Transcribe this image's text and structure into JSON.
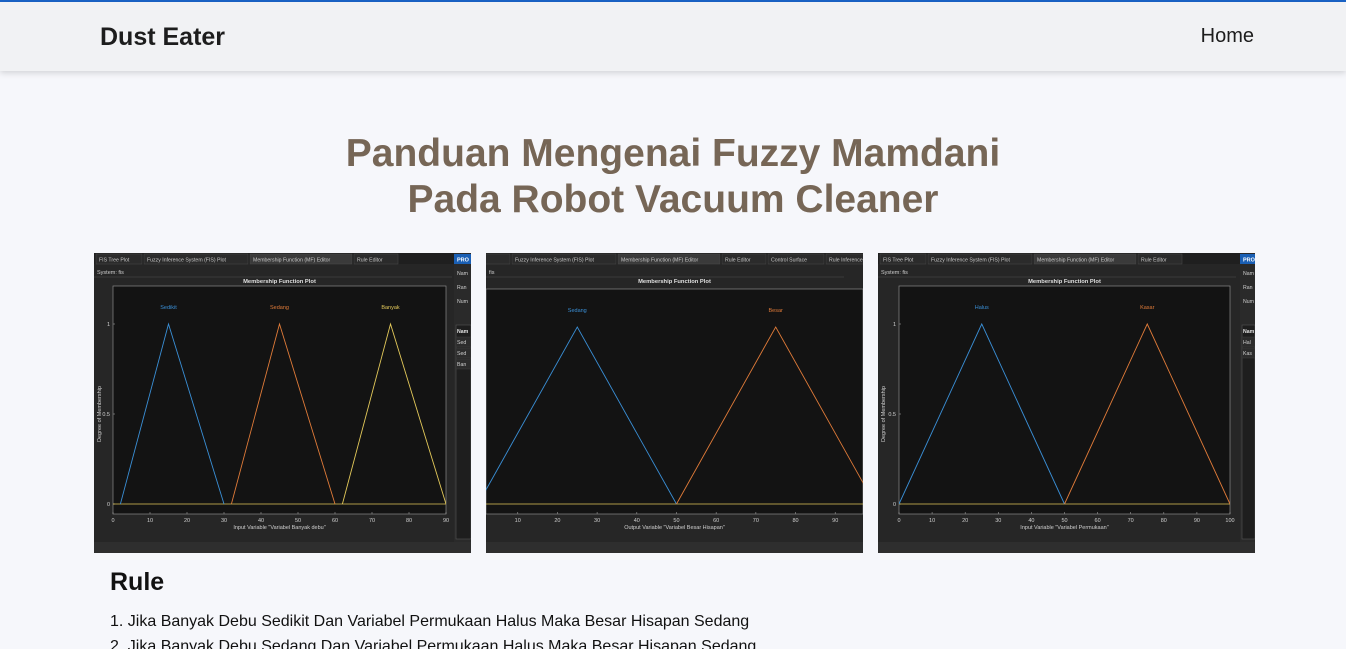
{
  "navbar": {
    "brand": "Dust Eater",
    "home_link": "Home"
  },
  "page": {
    "title_line1": "Panduan Mengenai Fuzzy Mamdani",
    "title_line2": "Pada Robot Vacuum Cleaner"
  },
  "colors": {
    "title": "#766656",
    "accent": "#1a64c8",
    "mf_blue": "#3a8fd6",
    "mf_orange": "#e07b39",
    "mf_yellow": "#e3c95a"
  },
  "panels": [
    {
      "tabs": [
        "FIS Tree Plot",
        "Fuzzy Inference System (FIS) Plot",
        "Membership Function (MF) Editor",
        "Rule Editor"
      ],
      "system_label": "System: fis",
      "plot_title": "Membership Function Plot",
      "xlabel": "Input Variable \"Variabel Banyak debu\"",
      "ylabel": "Degree of Membership",
      "xticks": [
        "0",
        "10",
        "20",
        "30",
        "40",
        "50",
        "60",
        "70",
        "80",
        "90"
      ],
      "yticks": [
        "0",
        "0.5",
        "1"
      ],
      "side_header": "PRO",
      "side_labels": [
        "Nam",
        "Ran",
        "Num"
      ],
      "side_table_header": "Nam",
      "side_rows": [
        "Sed",
        "Sed",
        "Ban"
      ],
      "chart_data": {
        "type": "line",
        "xlim": [
          0,
          90
        ],
        "ylim": [
          0,
          1
        ],
        "series": [
          {
            "name": "Sedikit",
            "color": "#3a8fd6",
            "x": [
              2,
              15,
              30
            ],
            "y": [
              0,
              1,
              0
            ]
          },
          {
            "name": "Sedang",
            "color": "#e07b39",
            "x": [
              32,
              45,
              60
            ],
            "y": [
              0,
              1,
              0
            ]
          },
          {
            "name": "Banyak",
            "color": "#e3c95a",
            "x": [
              62,
              75,
              90
            ],
            "y": [
              0,
              1,
              0
            ]
          }
        ]
      }
    },
    {
      "tabs": [
        "Plot",
        "Fuzzy Inference System (FIS) Plot",
        "Membership Function (MF) Editor",
        "Rule Editor",
        "Control Surface",
        "Rule Inference"
      ],
      "system_label": "fis",
      "plot_title": "Membership Function Plot",
      "xlabel": "Output Variable \"Variabel Besar Hisapan\"",
      "ylabel": "",
      "xticks": [
        "10",
        "20",
        "30",
        "40",
        "50",
        "60",
        "70",
        "80",
        "90"
      ],
      "yticks": [],
      "side_header": "",
      "side_labels": [],
      "side_table_header": "",
      "side_rows": [],
      "chart_data": {
        "type": "line",
        "xlim": [
          2,
          97
        ],
        "ylim": [
          0,
          1
        ],
        "series": [
          {
            "name": "Sedang",
            "color": "#3a8fd6",
            "x": [
              0,
              25,
              50
            ],
            "y": [
              0,
              1,
              0
            ]
          },
          {
            "name": "Besar",
            "color": "#e07b39",
            "x": [
              50,
              75,
              100
            ],
            "y": [
              0,
              1,
              0
            ]
          }
        ]
      }
    },
    {
      "tabs": [
        "FIS Tree Plot",
        "Fuzzy Inference System (FIS) Plot",
        "Membership Function (MF) Editor",
        "Rule Editor"
      ],
      "system_label": "System: fis",
      "plot_title": "Membership Function Plot",
      "xlabel": "Input Variable \"Variabel Permukaan\"",
      "ylabel": "Degree of Membership",
      "xticks": [
        "0",
        "10",
        "20",
        "30",
        "40",
        "50",
        "60",
        "70",
        "80",
        "90",
        "100"
      ],
      "yticks": [
        "0",
        "0.5",
        "1"
      ],
      "side_header": "PRO",
      "side_labels": [
        "Nam",
        "Ran",
        "Num"
      ],
      "side_table_header": "Nam",
      "side_rows": [
        "Hal",
        "Kas"
      ],
      "chart_data": {
        "type": "line",
        "xlim": [
          0,
          100
        ],
        "ylim": [
          0,
          1
        ],
        "series": [
          {
            "name": "Halus",
            "color": "#3a8fd6",
            "x": [
              0,
              25,
              50
            ],
            "y": [
              0,
              1,
              0
            ]
          },
          {
            "name": "Kasar",
            "color": "#e07b39",
            "x": [
              50,
              75,
              100
            ],
            "y": [
              0,
              1,
              0
            ]
          }
        ]
      }
    }
  ],
  "rules": {
    "heading": "Rule",
    "items": [
      "1. Jika Banyak Debu Sedikit Dan Variabel Permukaan Halus Maka Besar Hisapan Sedang",
      "2. Jika Banyak Debu Sedang Dan Variabel Permukaan Halus Maka Besar Hisapan Sedang"
    ]
  }
}
